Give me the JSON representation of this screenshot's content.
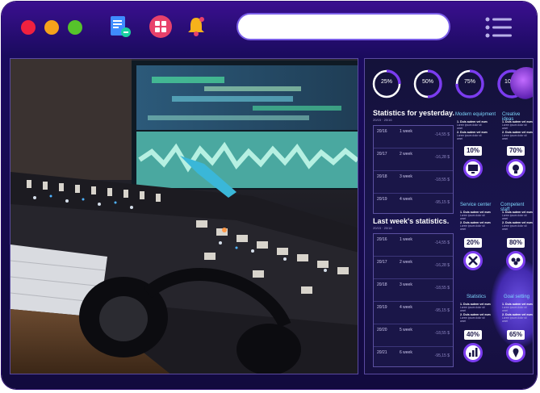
{
  "window": {
    "search_placeholder": ""
  },
  "titlebar": {
    "icons": [
      "document-icon",
      "apps-grid-icon",
      "bell-icon",
      "menu-icon"
    ]
  },
  "photo": {
    "subject": "audio-mixing-console-photo"
  },
  "dashboard": {
    "rings": [
      {
        "label": "25%",
        "value": 25
      },
      {
        "label": "50%",
        "value": 50
      },
      {
        "label": "75%",
        "value": 75
      },
      {
        "label": "100%",
        "value": 100
      }
    ],
    "yesterday": {
      "title": "Statistics for yesterday.",
      "subtitle": "20/15 · 20/16",
      "rows": [
        {
          "date": "20/16",
          "period": "1 week",
          "value": "-14,55 $"
        },
        {
          "date": "20/17",
          "period": "2 week",
          "value": "-16,28 $"
        },
        {
          "date": "20/18",
          "period": "3 week",
          "value": "-18,55 $"
        },
        {
          "date": "20/19",
          "period": "4 week",
          "value": "-95,15 $"
        }
      ]
    },
    "lastweek": {
      "title": "Last week's statistics.",
      "subtitle": "20/15 · 20/16",
      "rows": [
        {
          "date": "20/16",
          "period": "1 week",
          "value": "-14,55 $"
        },
        {
          "date": "20/17",
          "period": "2 week",
          "value": "-16,28 $"
        },
        {
          "date": "20/18",
          "period": "3 week",
          "value": "-18,55 $"
        },
        {
          "date": "20/19",
          "period": "4 week",
          "value": "-95,15 $"
        },
        {
          "date": "20/20",
          "period": "5 week",
          "value": "-18,55 $"
        },
        {
          "date": "20/21",
          "period": "6 week",
          "value": "-95,15 $"
        }
      ]
    },
    "columns": [
      {
        "title": "Modern equipment",
        "text1": "1. Duis autem vel eum",
        "text2": "2. Duis autem vel eum",
        "pct": "10%",
        "icon": "monitor-icon"
      },
      {
        "title": "Creative ideas",
        "text1": "1. Duis autem vel eum",
        "text2": "2. Duis autem vel eum",
        "pct": "70%",
        "icon": "lightbulb-icon"
      },
      {
        "title": "Service center",
        "text1": "1. Duis autem vel eum",
        "text2": "2. Duis autem vel eum",
        "pct": "20%",
        "icon": "tools-icon"
      },
      {
        "title": "Competent staff",
        "text1": "1. Duis autem vel eum",
        "text2": "2. Duis autem vel eum",
        "pct": "80%",
        "icon": "team-icon"
      },
      {
        "title": "Statistics",
        "text1": "1. Duis autem vel eum",
        "text2": "2. Duis autem vel eum",
        "pct": "40%",
        "icon": "bar-chart-icon"
      },
      {
        "title": "Goal setting",
        "text1": "1. Duis autem vel eum",
        "text2": "2. Duis autem vel eum",
        "pct": "65%",
        "icon": "location-pin-icon"
      }
    ]
  },
  "colors": {
    "accent": "#7b3cf0",
    "frame": "#1a0b5e",
    "cyan": "#7fd8ff"
  }
}
